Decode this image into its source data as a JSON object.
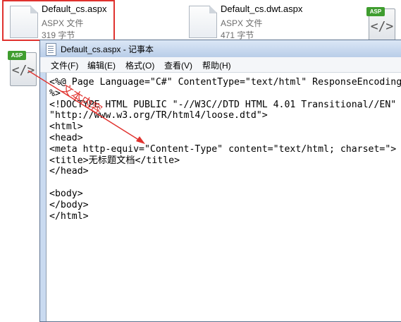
{
  "explorer": {
    "files": [
      {
        "name": "Default_cs.aspx",
        "type": "ASPX 文件",
        "size": "319 字节",
        "selected": true
      },
      {
        "name": "Default_cs.dwt.aspx",
        "type": "ASPX 文件",
        "size": "471 字节",
        "selected": false
      }
    ],
    "asp_badge": "ASP",
    "asp_glyph": "</>"
  },
  "notepad": {
    "title": "Default_cs.aspx - 记事本",
    "menu": [
      "文件(F)",
      "编辑(E)",
      "格式(O)",
      "查看(V)",
      "帮助(H)"
    ],
    "lines": [
      "<%@ Page Language=\"C#\" ContentType=\"text/html\" ResponseEncoding",
      "%>",
      "<!DOCTYPE HTML PUBLIC \"-//W3C//DTD HTML 4.01 Transitional//EN\"",
      "\"http://www.w3.org/TR/html4/loose.dtd\">",
      "<html>",
      "<head>",
      "<meta http-equiv=\"Content-Type\" content=\"text/html; charset=\">",
      "<title>无标题文档</title>",
      "</head>",
      "",
      "<body>",
      "</body>",
      "</html>"
    ]
  },
  "annotation": {
    "text": "文本内容",
    "color": "#e0322e"
  }
}
